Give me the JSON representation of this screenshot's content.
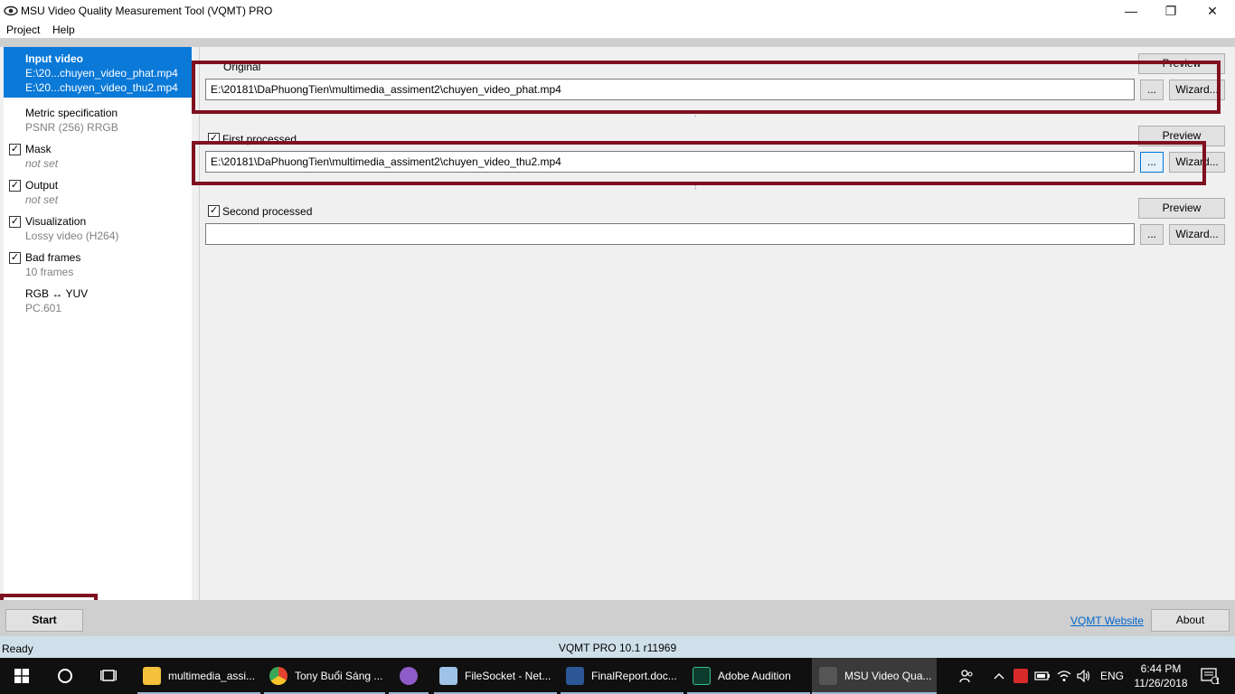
{
  "window": {
    "title": "MSU Video Quality Measurement Tool (VQMT) PRO",
    "minimize": "—",
    "restore": "❐",
    "close": "✕"
  },
  "menu": {
    "project": "Project",
    "help": "Help"
  },
  "sidebar": {
    "input_video": {
      "label": "Input video",
      "line1": "E:\\20...chuyen_video_phat.mp4",
      "line2": "E:\\20...chuyen_video_thu2.mp4"
    },
    "metric": {
      "label": "Metric specification",
      "sub": "PSNR (256) RRGB"
    },
    "mask": {
      "label": "Mask",
      "sub": "not set"
    },
    "output": {
      "label": "Output",
      "sub": "not set"
    },
    "visualization": {
      "label": "Visualization",
      "sub": "Lossy video (H264)"
    },
    "bad_frames": {
      "label": "Bad frames",
      "sub": "10 frames"
    },
    "rgb_yuv": {
      "label": "RGB ↔ YUV",
      "sub": "PC.601"
    },
    "check_mark": "✓"
  },
  "main": {
    "original": {
      "label": "Original",
      "path": "E:\\20181\\DaPhuongTien\\multimedia_assiment2\\chuyen_video_phat.mp4",
      "preview": "Preview",
      "browse": "...",
      "wizard": "Wizard..."
    },
    "first": {
      "label": "First processed",
      "path": "E:\\20181\\DaPhuongTien\\multimedia_assiment2\\chuyen_video_thu2.mp4",
      "preview": "Preview",
      "browse": "...",
      "wizard": "Wizard..."
    },
    "second": {
      "label": "Second processed",
      "path": "",
      "preview": "Preview",
      "browse": "...",
      "wizard": "Wizard..."
    },
    "arrow": "↕"
  },
  "bottom": {
    "start": "Start",
    "website": "VQMT Website",
    "about": "About"
  },
  "status": {
    "ready": "Ready",
    "version": "VQMT PRO 10.1 r11969"
  },
  "taskbar": {
    "apps": [
      {
        "label": "multimedia_assi...",
        "color": "#f3c13a"
      },
      {
        "label": "Tony Buổi Sáng ...",
        "color": "#e0442e"
      },
      {
        "label": "",
        "color": "#8e5cc8"
      },
      {
        "label": "FileSocket - Net...",
        "color": "#9ec3e6"
      },
      {
        "label": "FinalReport.doc...",
        "color": "#2b5797"
      },
      {
        "label": "Adobe Audition",
        "color": "#0d3b2e"
      },
      {
        "label": "MSU Video Qua...",
        "color": "#555555"
      }
    ],
    "lang": "ENG",
    "time": "6:44 PM",
    "date": "11/26/2018",
    "notif_count": "1"
  }
}
